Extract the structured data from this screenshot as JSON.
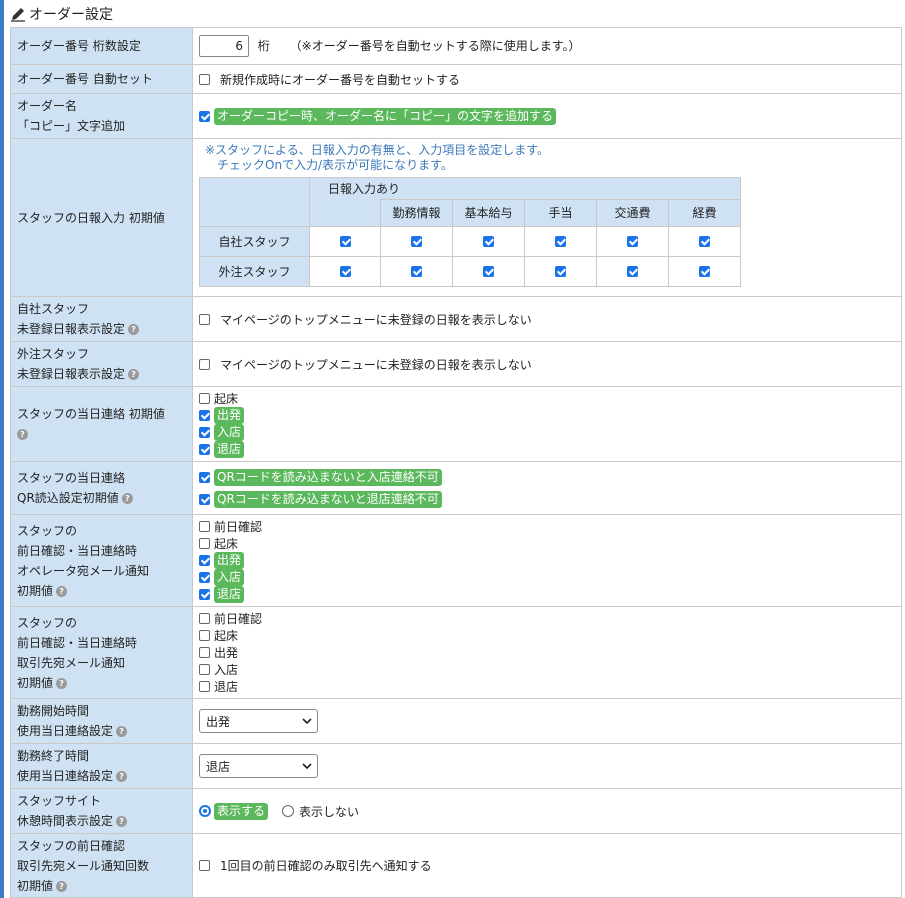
{
  "section_title": "オーダー設定",
  "rows": {
    "digits": {
      "label": "オーダー番号 桁数設定",
      "value": "6",
      "unit": "桁",
      "note": "（※オーダー番号を自動セットする際に使用します。）"
    },
    "autoset": {
      "label": "オーダー番号 自動セット",
      "checkbox": "新規作成時にオーダー番号を自動セットする"
    },
    "copyname": {
      "label1": "オーダー名",
      "label2": "「コピー」文字追加",
      "checkbox": "オーダーコピー時、オーダー名に「コピー」の文字を追加する"
    },
    "daily": {
      "label": "スタッフの日報入力 初期値",
      "note1": "※スタッフによる、日報入力の有無と、入力項目を設定します。",
      "note2": "チェックOnで入力/表示が可能になります。",
      "group_header": "日報入力あり",
      "columns": [
        "勤務情報",
        "基本給与",
        "手当",
        "交通費",
        "経費"
      ],
      "row_labels": [
        "自社スタッフ",
        "外注スタッフ"
      ]
    },
    "own_unreg": {
      "label1": "自社スタッフ",
      "label2": "未登録日報表示設定",
      "checkbox": "マイページのトップメニューに未登録の日報を表示しない"
    },
    "ext_unreg": {
      "label1": "外注スタッフ",
      "label2": "未登録日報表示設定",
      "checkbox": "マイページのトップメニューに未登録の日報を表示しない"
    },
    "sameday": {
      "label": "スタッフの当日連絡 初期値",
      "items": [
        "起床",
        "出発",
        "入店",
        "退店"
      ]
    },
    "qr": {
      "label1": "スタッフの当日連絡",
      "label2": "QR読込設定初期値",
      "items": [
        "QRコードを読み込まないと入店連絡不可",
        "QRコードを読み込まないと退店連絡不可"
      ]
    },
    "opmail": {
      "label1": "スタッフの",
      "label2": "前日確認・当日連絡時",
      "label3": "オペレータ宛メール通知",
      "label4": "初期値",
      "items": [
        "前日確認",
        "起床",
        "出発",
        "入店",
        "退店"
      ]
    },
    "clientmail": {
      "label1": "スタッフの",
      "label2": "前日確認・当日連絡時",
      "label3": "取引先宛メール通知",
      "label4": "初期値",
      "items": [
        "前日確認",
        "起床",
        "出発",
        "入店",
        "退店"
      ]
    },
    "start": {
      "label1": "勤務開始時間",
      "label2": "使用当日連絡設定",
      "selected": "出発"
    },
    "end": {
      "label1": "勤務終了時間",
      "label2": "使用当日連絡設定",
      "selected": "退店"
    },
    "rest": {
      "label1": "スタッフサイト",
      "label2": "休憩時間表示設定",
      "show": "表示する",
      "hide": "表示しない"
    },
    "prevconfirm": {
      "label1": "スタッフの前日確認",
      "label2": "取引先宛メール通知回数",
      "label3": "初期値",
      "checkbox": "1回目の前日確認のみ取引先へ通知する"
    }
  },
  "help_glyph": "?",
  "icons": {
    "pencil": "pencil-icon",
    "help": "help-icon",
    "chevron": "chevron-down-icon"
  },
  "colors": {
    "header_bg": "#cfe2f3",
    "highlight": "#5cb85c",
    "check": "#1a73e8",
    "note": "#3c78b8",
    "left_bar": "#3d7dc8"
  }
}
